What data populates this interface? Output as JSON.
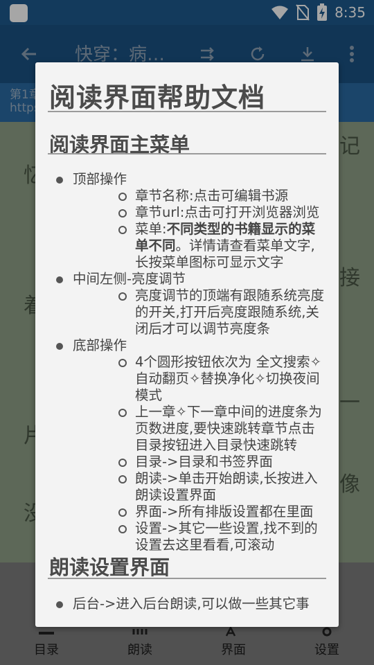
{
  "status": {
    "time": "8:35"
  },
  "toolbar": {
    "title": "快穿：病…"
  },
  "chapter": {
    "line1": "第1章",
    "line2": "https"
  },
  "reader_bg": {
    "t1": "忆",
    "t2": "着",
    "t3": "片",
    "t4": "没",
    "r1": "记",
    "r2": "接",
    "r3": "一",
    "r4": "像"
  },
  "bottom": {
    "items": [
      {
        "label": "目录",
        "icon": "catalog-icon"
      },
      {
        "label": "朗读",
        "icon": "read-aloud-icon"
      },
      {
        "label": "界面",
        "icon": "interface-icon"
      },
      {
        "label": "设置",
        "icon": "settings-icon"
      }
    ]
  },
  "dialog": {
    "title": "阅读界面帮助文档",
    "section1": "阅读界面主菜单",
    "top_ops": "顶部操作",
    "top_items": [
      "章节名称:点击可编辑书源",
      "章节url:点击可打开浏览器浏览"
    ],
    "menu_prefix": "菜单:",
    "menu_bold": "不同类型的书籍显示的菜单不同",
    "menu_rest": "。详情请查看菜单文字,长按菜单图标可显示文字",
    "mid_ops": "中间左侧-亮度调节",
    "mid_items": [
      "亮度调节的顶端有跟随系统亮度的开关,打开后亮度跟随系统,关闭后才可以调节亮度条"
    ],
    "bottom_ops": "底部操作",
    "bottom_items": [
      "4个圆形按钮依次为 全文搜索✧自动翻页✧替换净化✧切换夜间模式",
      "上一章✧下一章中间的进度条为页数进度,要快速跳转章节点击目录按钮进入目录快速跳转",
      "目录->目录和书签界面",
      "朗读->单击开始朗读,长按进入朗读设置界面",
      "界面->所有排版设置都在里面",
      "设置->其它一些设置,找不到的设置去这里看看,可滚动"
    ],
    "section2": "朗读设置界面",
    "section2_items": [
      "后台->进入后台朗读,可以做一些其它事"
    ]
  }
}
